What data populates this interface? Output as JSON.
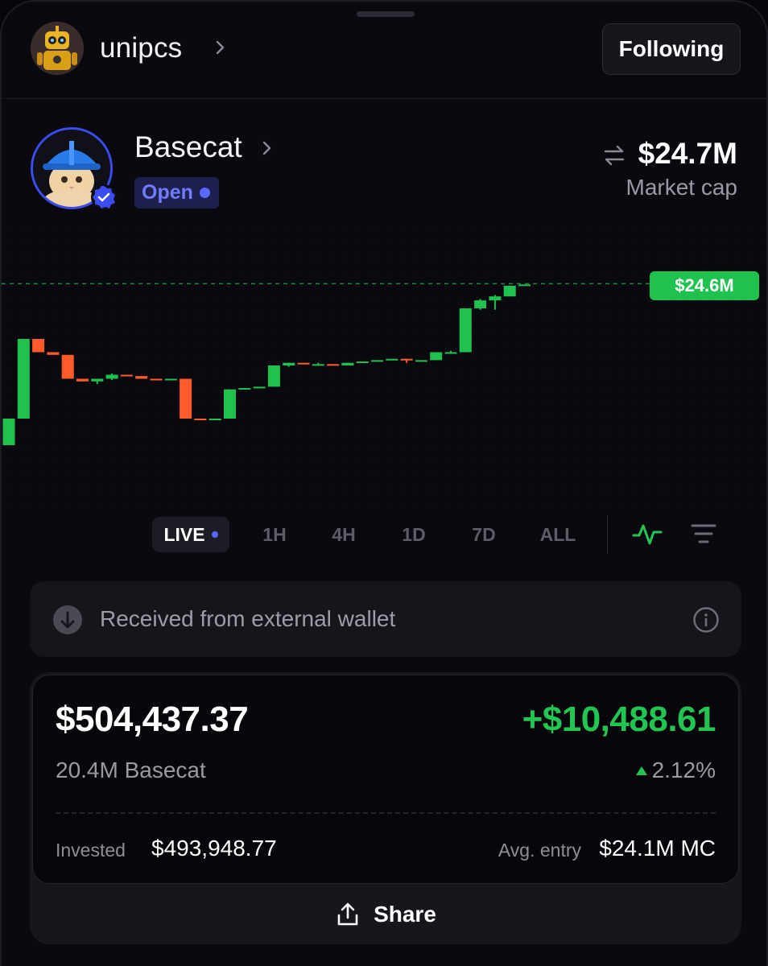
{
  "header": {
    "username": "unipcs",
    "follow_label": "Following"
  },
  "token": {
    "name": "Basecat",
    "status": "Open",
    "market_cap": "$24.7M",
    "market_cap_label": "Market cap"
  },
  "chart_data": {
    "type": "candlestick",
    "current_price_label": "$24.6M",
    "up_color": "#1fc24e",
    "down_color": "#ff5a2a",
    "unit": "market cap ($M, estimated)",
    "candles": [
      {
        "o": 23.4,
        "h": 23.6,
        "l": 23.4,
        "c": 23.6
      },
      {
        "o": 23.6,
        "h": 24.2,
        "l": 23.6,
        "c": 24.2
      },
      {
        "o": 24.2,
        "h": 24.2,
        "l": 24.1,
        "c": 24.1
      },
      {
        "o": 24.1,
        "h": 24.1,
        "l": 24.08,
        "c": 24.08
      },
      {
        "o": 24.08,
        "h": 24.08,
        "l": 23.9,
        "c": 23.9
      },
      {
        "o": 23.9,
        "h": 23.9,
        "l": 23.88,
        "c": 23.88
      },
      {
        "o": 23.88,
        "h": 23.9,
        "l": 23.86,
        "c": 23.9
      },
      {
        "o": 23.9,
        "h": 23.94,
        "l": 23.89,
        "c": 23.93
      },
      {
        "o": 23.93,
        "h": 23.93,
        "l": 23.92,
        "c": 23.92
      },
      {
        "o": 23.92,
        "h": 23.92,
        "l": 23.9,
        "c": 23.9
      },
      {
        "o": 23.9,
        "h": 23.9,
        "l": 23.89,
        "c": 23.89
      },
      {
        "o": 23.89,
        "h": 23.9,
        "l": 23.89,
        "c": 23.9
      },
      {
        "o": 23.9,
        "h": 23.9,
        "l": 23.6,
        "c": 23.6
      },
      {
        "o": 23.6,
        "h": 23.6,
        "l": 23.59,
        "c": 23.59
      },
      {
        "o": 23.59,
        "h": 23.6,
        "l": 23.59,
        "c": 23.6
      },
      {
        "o": 23.6,
        "h": 23.82,
        "l": 23.6,
        "c": 23.82
      },
      {
        "o": 23.82,
        "h": 23.83,
        "l": 23.82,
        "c": 23.83
      },
      {
        "o": 23.83,
        "h": 23.84,
        "l": 23.83,
        "c": 23.84
      },
      {
        "o": 23.84,
        "h": 24.0,
        "l": 23.84,
        "c": 24.0
      },
      {
        "o": 24.0,
        "h": 24.02,
        "l": 23.99,
        "c": 24.02
      },
      {
        "o": 24.02,
        "h": 24.02,
        "l": 24.01,
        "c": 24.01
      },
      {
        "o": 24.01,
        "h": 24.02,
        "l": 24.01,
        "c": 24.01
      },
      {
        "o": 24.01,
        "h": 24.01,
        "l": 24.0,
        "c": 24.0
      },
      {
        "o": 24.0,
        "h": 24.02,
        "l": 24.0,
        "c": 24.02
      },
      {
        "o": 24.02,
        "h": 24.03,
        "l": 24.02,
        "c": 24.03
      },
      {
        "o": 24.03,
        "h": 24.04,
        "l": 24.03,
        "c": 24.04
      },
      {
        "o": 24.04,
        "h": 24.05,
        "l": 24.04,
        "c": 24.05
      },
      {
        "o": 24.05,
        "h": 24.05,
        "l": 24.02,
        "c": 24.04
      },
      {
        "o": 24.04,
        "h": 24.04,
        "l": 24.03,
        "c": 24.04
      },
      {
        "o": 24.04,
        "h": 24.1,
        "l": 24.04,
        "c": 24.1
      },
      {
        "o": 24.1,
        "h": 24.11,
        "l": 24.1,
        "c": 24.1
      },
      {
        "o": 24.1,
        "h": 24.43,
        "l": 24.1,
        "c": 24.43
      },
      {
        "o": 24.43,
        "h": 24.5,
        "l": 24.42,
        "c": 24.49
      },
      {
        "o": 24.49,
        "h": 24.53,
        "l": 24.42,
        "c": 24.52
      },
      {
        "o": 24.52,
        "h": 24.6,
        "l": 24.52,
        "c": 24.6
      },
      {
        "o": 24.6,
        "h": 24.61,
        "l": 24.6,
        "c": 24.61
      }
    ]
  },
  "timeframes": [
    {
      "label": "LIVE",
      "active": true
    },
    {
      "label": "1H",
      "active": false
    },
    {
      "label": "4H",
      "active": false
    },
    {
      "label": "1D",
      "active": false
    },
    {
      "label": "7D",
      "active": false
    },
    {
      "label": "ALL",
      "active": false
    }
  ],
  "received_banner": {
    "text": "Received from external wallet"
  },
  "holding": {
    "value": "$504,437.37",
    "pnl": "+$10,488.61",
    "quantity": "20.4M Basecat",
    "pnl_percent": "2.12%",
    "invested_label": "Invested",
    "invested_value": "$493,948.77",
    "avg_entry_label": "Avg. entry",
    "avg_entry_value": "$24.1M MC"
  },
  "share_label": "Share",
  "icons": {
    "user_avatar": "robot-avatar-icon",
    "token_avatar": "cat-hardhat-avatar-icon",
    "verified": "verified-badge-icon",
    "swap": "swap-arrows-icon",
    "wave": "line-chart-icon",
    "filter": "filter-lines-icon",
    "received": "arrow-down-circle-icon",
    "info": "info-icon",
    "share": "share-icon"
  }
}
